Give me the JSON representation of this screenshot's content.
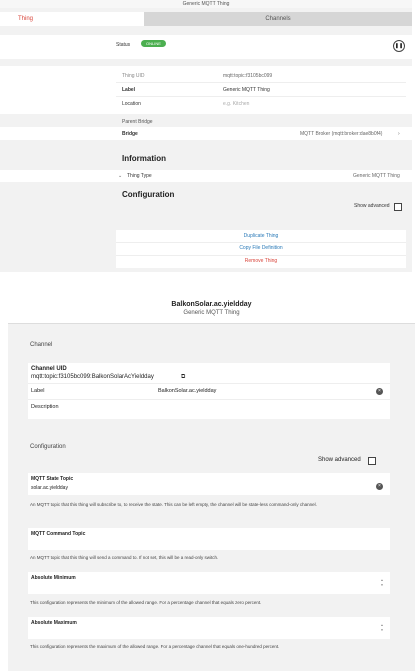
{
  "panel1": {
    "window_title": "Generic MQTT Thing",
    "tabs": [
      {
        "label": "Thing"
      },
      {
        "label": "Channels"
      }
    ],
    "status_label": "Status",
    "status_badge": "ONLINE",
    "status_action_icon": "pause-icon",
    "thing_uid_label": "Thing UID",
    "thing_uid_value": "mqtt:topic:f3105bc099",
    "label_label": "Label",
    "label_value": "Generic MQTT Thing",
    "location_label": "Location",
    "location_placeholder": "e.g. Kitchen",
    "parent_bridge_label": "Parent Bridge",
    "bridge_label": "Bridge",
    "bridge_value": "MQTT Broker (mqtt:broker:dae8b0f4)",
    "information_header": "Information",
    "thing_type_label": "Thing Type",
    "thing_type_value": "Generic MQTT Thing",
    "configuration_header": "Configuration",
    "show_advanced": "Show advanced",
    "duplicate_thing": "Duplicate Thing",
    "copy_file_definition": "Copy File Definition",
    "remove_thing": "Remove Thing"
  },
  "panel2": {
    "title": "BalkonSolar.ac.yieldday",
    "subtitle": "Generic MQTT Thing",
    "channel_section": "Channel",
    "channel_uid_label": "Channel UID",
    "channel_uid_value": "mqtt:topic:f3105bc099:BalkonSolarAcYieldday",
    "label_label": "Label",
    "label_value": "BalkonSolar.ac.yieldday",
    "description_label": "Description",
    "configuration_section": "Configuration",
    "show_advanced": "Show advanced",
    "state_topic_label": "MQTT State Topic",
    "state_topic_value": "solar.ac.yieldday",
    "state_topic_desc": "An MQTT topic that this thing will subscribe to, to receive the state. This can be left empty, the channel will be state-less command-only channel.",
    "command_topic_label": "MQTT Command Topic",
    "command_topic_desc": "An MQTT topic that this thing will send a command to. If not set, this will be a read-only switch.",
    "abs_min_label": "Absolute Minimum",
    "abs_min_desc": "This configuration represents the minimum of the allowed range. For a percentage channel that equals zero percent.",
    "abs_max_label": "Absolute Maximum",
    "abs_max_desc": "This configuration represents the maximum of the allowed range. For a percentage channel that equals one-hundred percent."
  }
}
